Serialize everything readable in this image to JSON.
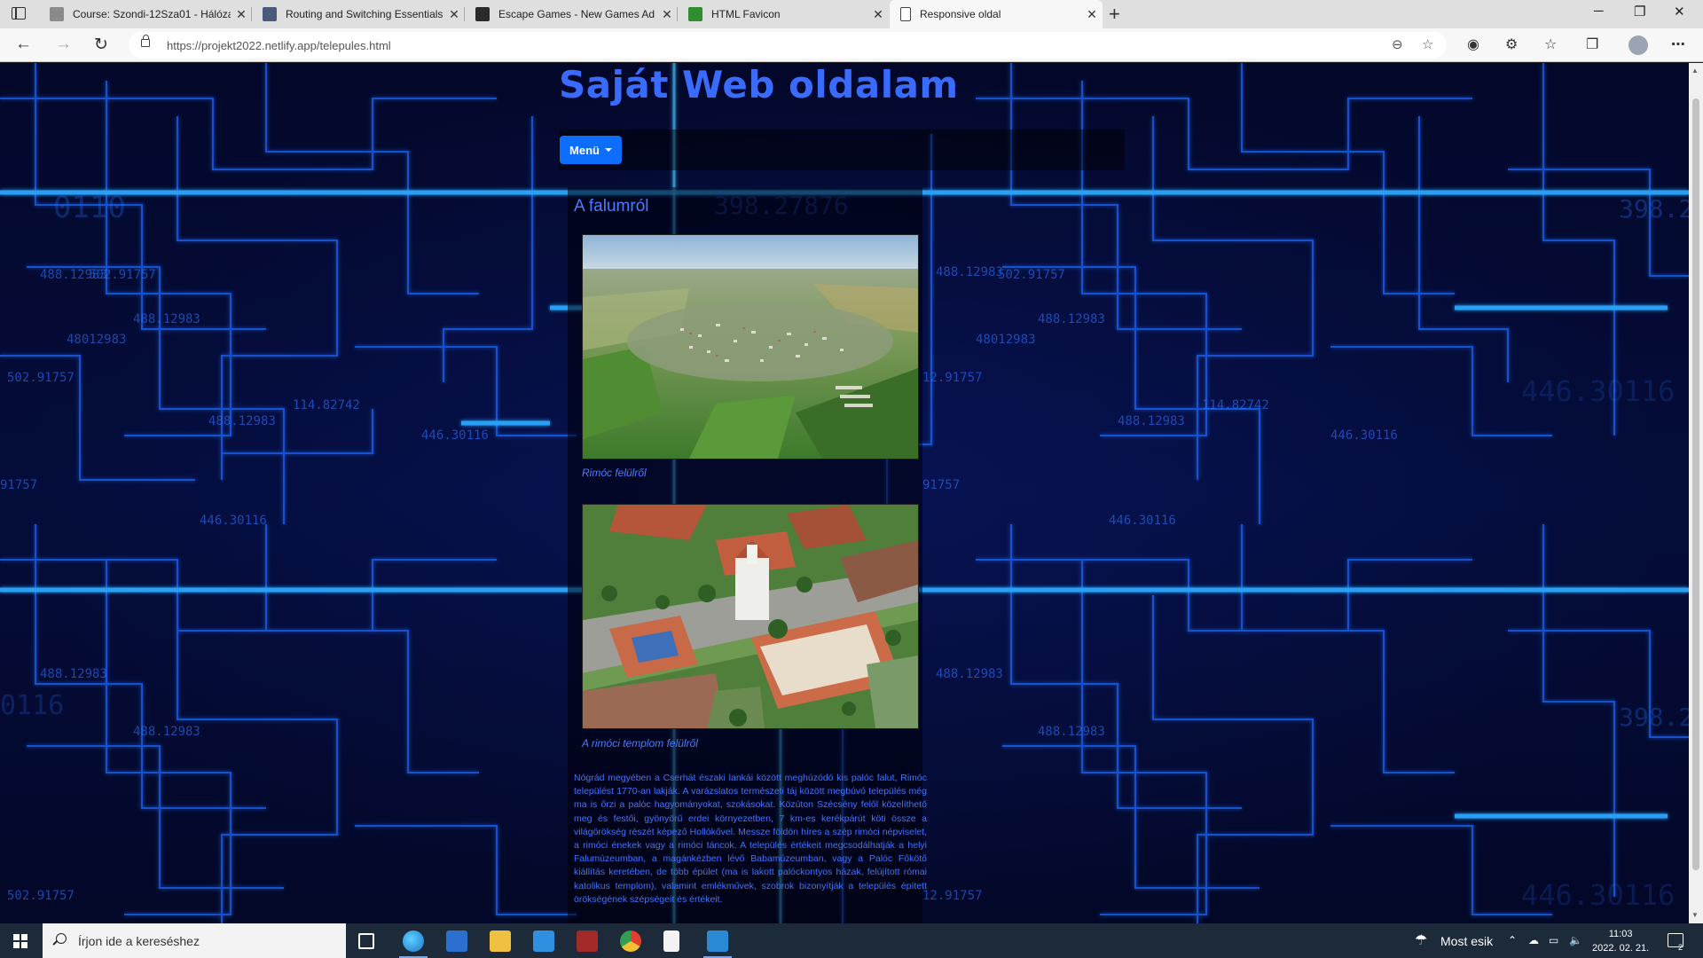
{
  "browser": {
    "tabs": [
      {
        "title": "Course: Szondi-12Sza01 - Hálóza",
        "favicon_color": "#8a8a8a",
        "active": false
      },
      {
        "title": "Routing and Switching Essentials",
        "favicon_color": "#4a5a7a",
        "active": false
      },
      {
        "title": "Escape Games - New Games Ad",
        "favicon_color": "#2a2a2a",
        "active": false
      },
      {
        "title": "HTML Favicon",
        "favicon_color": "#2f8f2f",
        "active": false
      },
      {
        "title": "Responsive oldal",
        "favicon_color": "#ffffff",
        "active": true
      }
    ],
    "tab_close": "✕",
    "new_tab": "+",
    "window_controls": {
      "minimize": "─",
      "restore": "❐",
      "close": "✕"
    },
    "nav": {
      "back": "←",
      "forward": "→",
      "reload": "↻"
    },
    "url": "https://projekt2022.netlify.app/telepules.html",
    "toolbar_icons": [
      "zoom-icon",
      "favorite-add-icon",
      "read-aloud-icon",
      "extensions-icon",
      "favorites-icon",
      "collections-icon",
      "profile-icon",
      "more-icon"
    ]
  },
  "site": {
    "title": "Saját Web oldalam",
    "menu_label": "Menü",
    "section_heading": "A falumról",
    "photos": [
      {
        "caption": "Rimóc felülről"
      },
      {
        "caption": "A rimóci templom felülről"
      }
    ],
    "description": "Nógrád megyében a Cserhát északi lankái között meghúzódó kis palóc falut, Rimóc települést 1770-an lakják. A varázslatos természeti táj között megbúvó település még ma is őrzi a palóc hagyományokat, szokásokat. Közúton Szécsény felől közelíthető meg és festői, gyönyörű erdei környezetben, 7 km-es kerékpárút köti össze a világörökség részét képező Hollókővel. Messze földön híres a szép rimóci népviselet, a rimóci énekek vagy a rimóci táncok. A település értékeit megcsodálhatják a helyi Falumúzeumban, a magánkézben lévő Babamúzeumban, vagy a Palóc Főkötő kiállítás keretében, de több épület (ma is lakott palóckontyos házak, felújított római katolikus templom), valamint emlékművek, szobrok bizonyítják a település épített örökségének szépségeit és értékeit.",
    "accent_color": "#3a6bff",
    "button_color": "#0d6efd"
  },
  "taskbar": {
    "search_placeholder": "Írjon ide a kereséshez",
    "weather": "Most esik",
    "time": "11:03",
    "date": "2022. 02. 21.",
    "notifications": "2"
  }
}
